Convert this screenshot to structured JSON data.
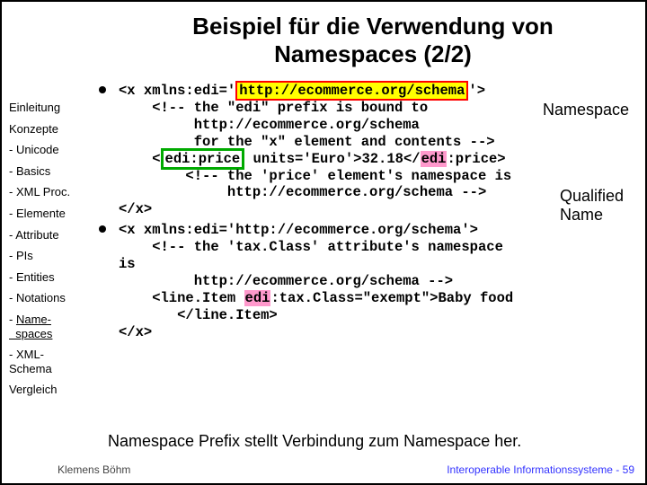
{
  "title_l1": "Beispiel für die Verwendung von",
  "title_l2": "Namespaces (2/2)",
  "sidebar": {
    "items": [
      "Einleitung",
      "Konzepte",
      "- Unicode",
      "- Basics",
      "- XML Proc.",
      "- Elemente",
      "- Attribute",
      "- PIs",
      "- Entities",
      "- Notations",
      "- Name-\n  spaces",
      "- XML-\n  Schema",
      "Vergleich"
    ],
    "current_index": 10
  },
  "code1": {
    "l1a": "<x xmlns:edi='",
    "l1_hl": "http://ecommerce.org/schema",
    "l1b": "'>",
    "l2": "    <!-- the \"edi\" prefix is bound to",
    "l3": "         http://ecommerce.org/schema",
    "l4": "         for the \"x\" element and contents -->",
    "l5a": "    <",
    "l5_box": "edi:price",
    "l5b": " units='Euro'>32.18</",
    "l5_pink": "edi",
    "l5c": ":price>",
    "l6": "        <!-- the 'price' element's namespace is",
    "l7": "             http://ecommerce.org/schema -->",
    "l8": "</x>"
  },
  "code2": {
    "l1": "<x xmlns:edi='http://ecommerce.org/schema'>",
    "l2": "    <!-- the 'tax.Class' attribute's namespace",
    "l2b": "is",
    "l3": "         http://ecommerce.org/schema -->",
    "l4a": "    <line.Item ",
    "l4_pink": "edi",
    "l4b": ":tax.Class=\"exempt\">Baby food",
    "l5": "       </line.Item>",
    "l6": "</x>"
  },
  "annot": {
    "namespace": "Namespace",
    "qualified1": "Qualified",
    "qualified2": "Name"
  },
  "bottom_note": "Namespace Prefix stellt Verbindung zum Namespace her.",
  "footer_left": "Klemens Böhm",
  "footer_right": "Interoperable Informationssysteme - 59"
}
